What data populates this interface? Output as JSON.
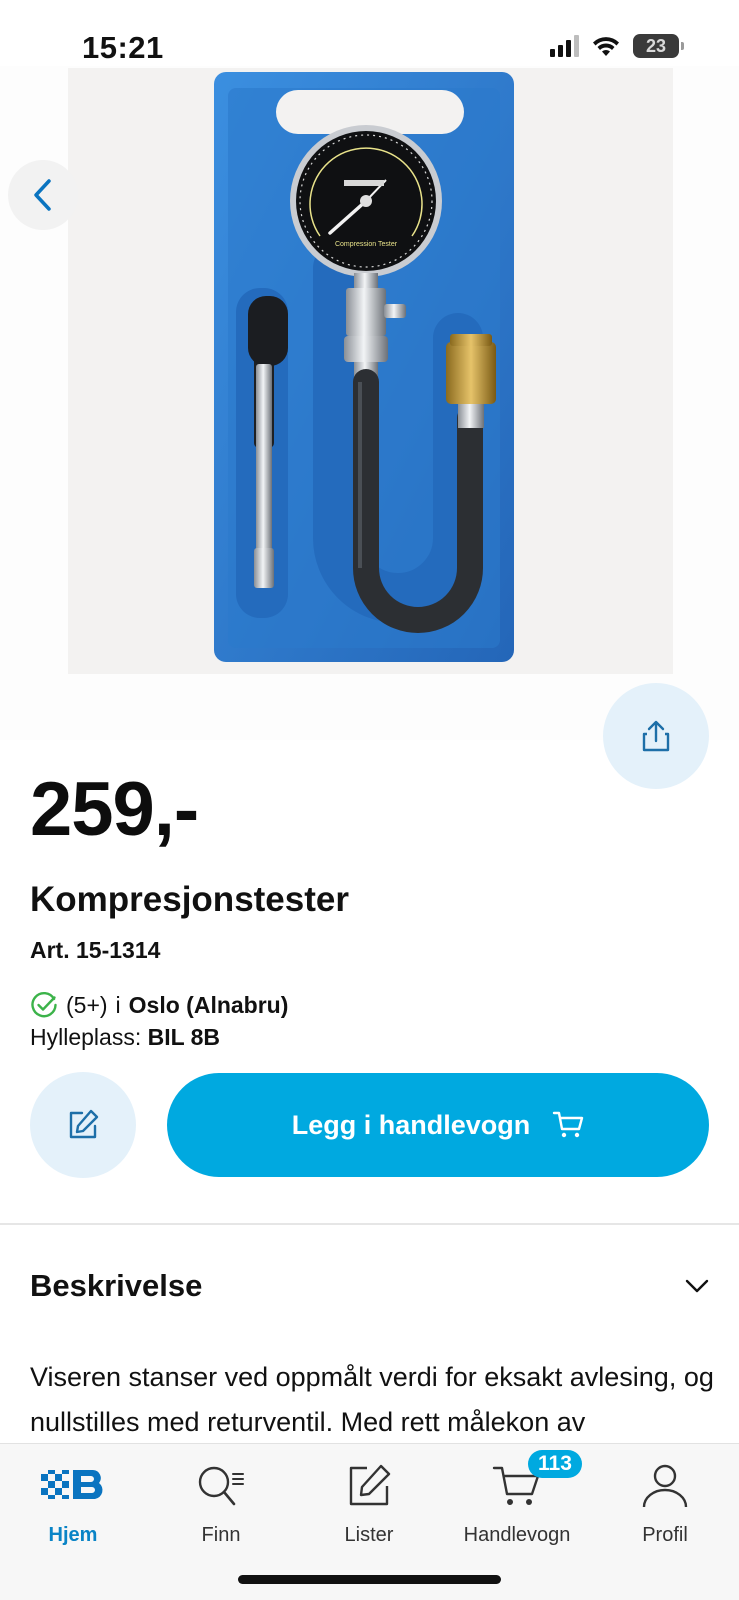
{
  "status_bar": {
    "time": "15:21",
    "battery": "23",
    "icons": [
      "signal-icon",
      "wifi-icon",
      "battery-icon"
    ]
  },
  "product": {
    "image_alt": "Kompresjonstester",
    "gauge_label": "Compression Tester",
    "price": "259,-",
    "name": "Kompresjonstester",
    "article": "Art. 15-1314",
    "stock": {
      "count": "(5+)",
      "preposition": "i",
      "location": "Oslo (Alnabru)"
    },
    "shelf": {
      "label": "Hylleplass:",
      "value": "BIL 8B"
    }
  },
  "actions": {
    "add_to_cart_label": "Legg i handlevogn"
  },
  "description": {
    "title": "Beskrivelse",
    "text": "Viseren stanser ved oppmålt verdi for eksakt avlesing, og nullstilles med returventil. Med rett målekon av"
  },
  "bottom_nav": {
    "items": [
      {
        "label": "Hjem",
        "icon": "home-logo-icon",
        "active": true
      },
      {
        "label": "Finn",
        "icon": "search-list-icon"
      },
      {
        "label": "Lister",
        "icon": "edit-list-icon"
      },
      {
        "label": "Handlevogn",
        "icon": "cart-icon",
        "badge": "113"
      },
      {
        "label": "Profil",
        "icon": "profile-icon"
      }
    ]
  },
  "colors": {
    "accent": "#00a9e0",
    "nav_active": "#0a84c6",
    "soft_button": "#e4f1fa",
    "case_blue": "#2f7fd0",
    "stock_ok": "#3cb34a"
  }
}
